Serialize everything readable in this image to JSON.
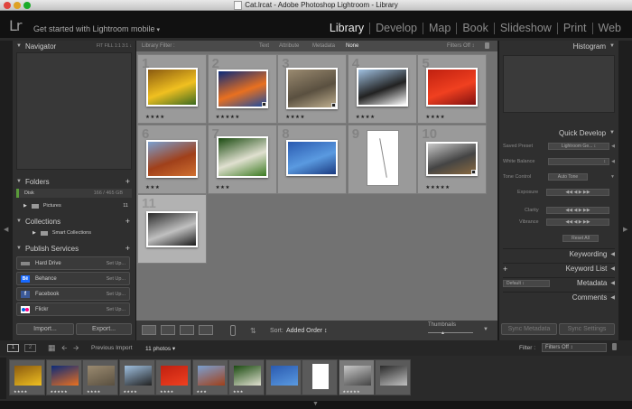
{
  "window": {
    "title": "Cat.lrcat - Adobe Photoshop Lightroom - Library"
  },
  "identity": {
    "logo": "Lr",
    "mobile_label": "Get started with Lightroom mobile"
  },
  "modules": [
    "Library",
    "Develop",
    "Map",
    "Book",
    "Slideshow",
    "Print",
    "Web"
  ],
  "left_panel": {
    "navigator": {
      "title": "Navigator",
      "zoom_options": "FIT  FILL  1:1  3:1 ↓"
    },
    "folders": {
      "title": "Folders",
      "disk": {
        "name": "Disk",
        "usage": "166 / 465 GB"
      },
      "items": [
        {
          "name": "Pictures",
          "count": "11"
        }
      ]
    },
    "collections": {
      "title": "Collections",
      "items": [
        {
          "name": "Smart Collections"
        }
      ]
    },
    "publish": {
      "title": "Publish Services",
      "items": [
        {
          "name": "Hard Drive",
          "setup": "Set Up..."
        },
        {
          "name": "Behance",
          "setup": "Set Up..."
        },
        {
          "name": "Facebook",
          "setup": "Set Up..."
        },
        {
          "name": "Flickr",
          "setup": "Set Up..."
        }
      ]
    },
    "import_label": "Import...",
    "export_label": "Export..."
  },
  "library_filter": {
    "title": "Library Filter :",
    "options": [
      "Text",
      "Attribute",
      "Metadata",
      "None"
    ],
    "active": "None",
    "filters_off": "Filters Off ↕"
  },
  "grid": {
    "cells": [
      {
        "num": "1",
        "stars": "★★★★",
        "colors": [
          "#8a5a10",
          "#f0c020",
          "#3a6a20"
        ]
      },
      {
        "num": "2",
        "stars": "★★★★★",
        "colors": [
          "#0a2a7a",
          "#e87020",
          "#1a4aa0"
        ]
      },
      {
        "num": "3",
        "stars": "★★★★",
        "colors": [
          "#9a8a70",
          "#5a5040",
          "#c0b090"
        ]
      },
      {
        "num": "4",
        "stars": "★★★★",
        "colors": [
          "#a0c0e0",
          "#222222",
          "#ffffff"
        ]
      },
      {
        "num": "5",
        "stars": "★★★★",
        "colors": [
          "#c02010",
          "#f04020",
          "#801010"
        ]
      },
      {
        "num": "6",
        "stars": "★★★",
        "colors": [
          "#7aa0d0",
          "#a0401a",
          "#d07030"
        ]
      },
      {
        "num": "7",
        "stars": "★★★",
        "colors": [
          "#1a4a10",
          "#e0e0d0",
          "#3a7a20"
        ]
      },
      {
        "num": "8",
        "stars": "",
        "colors": [
          "#2a5ab0",
          "#5a9ae0",
          "#1a3a80"
        ]
      },
      {
        "num": "9",
        "stars": "",
        "colors": [
          "#ffffff",
          "#888888",
          "#ffffff"
        ]
      },
      {
        "num": "10",
        "stars": "★★★★★",
        "colors": [
          "#c8c8c8",
          "#444444",
          "#8a6a40"
        ]
      },
      {
        "num": "11",
        "stars": "",
        "colors": [
          "#2a2a2a",
          "#c0c0c0",
          "#1a1a1a"
        ]
      }
    ]
  },
  "toolbar": {
    "sort_label": "Sort:",
    "sort_value": "Added Order ↕",
    "thumbnails_label": "Thumbnails"
  },
  "right_panel": {
    "histogram": {
      "title": "Histogram"
    },
    "quick_develop": {
      "title": "Quick Develop",
      "saved_preset": {
        "label": "Saved Preset",
        "value": "Lightroom Ge... ↕"
      },
      "white_balance": {
        "label": "White Balance",
        "value": "↕"
      },
      "tone_control": {
        "label": "Tone Control",
        "value": "Auto Tone"
      },
      "exposure": {
        "label": "Exposure"
      },
      "clarity": {
        "label": "Clarity"
      },
      "vibrance": {
        "label": "Vibrance"
      },
      "reset_label": "Reset All"
    },
    "keywording": {
      "title": "Keywording"
    },
    "keyword_list": {
      "title": "Keyword List",
      "plus": "+"
    },
    "metadata": {
      "title": "Metadata",
      "preset": "Default ↕"
    },
    "comments": {
      "title": "Comments"
    },
    "sync_metadata": "Sync Metadata",
    "sync_settings": "Sync Settings"
  },
  "filmstrip_bar": {
    "page1": "1",
    "page2": "2",
    "source": "Previous Import",
    "count": "11 photos ▾",
    "filter_label": "Filter :",
    "filter_value": "Filters Off ↕"
  },
  "filmstrip": {
    "thumbs": [
      {
        "stars": "★★★★",
        "colors": [
          "#8a5a10",
          "#f0c020"
        ]
      },
      {
        "stars": "★★★★★",
        "colors": [
          "#0a2a7a",
          "#e87020"
        ]
      },
      {
        "stars": "★★★★",
        "colors": [
          "#9a8a70",
          "#5a5040"
        ]
      },
      {
        "stars": "★★★★",
        "colors": [
          "#a0c0e0",
          "#222222"
        ]
      },
      {
        "stars": "★★★★",
        "colors": [
          "#c02010",
          "#f04020"
        ]
      },
      {
        "stars": "★★★",
        "colors": [
          "#7aa0d0",
          "#a0401a"
        ]
      },
      {
        "stars": "★★★",
        "colors": [
          "#1a4a10",
          "#e0e0d0"
        ]
      },
      {
        "stars": "",
        "colors": [
          "#2a5ab0",
          "#5a9ae0"
        ]
      },
      {
        "stars": "",
        "colors": [
          "#ffffff",
          "#888888"
        ]
      },
      {
        "stars": "★★★★★",
        "colors": [
          "#c8c8c8",
          "#444444"
        ]
      },
      {
        "stars": "",
        "colors": [
          "#2a2a2a",
          "#c0c0c0"
        ]
      }
    ]
  }
}
